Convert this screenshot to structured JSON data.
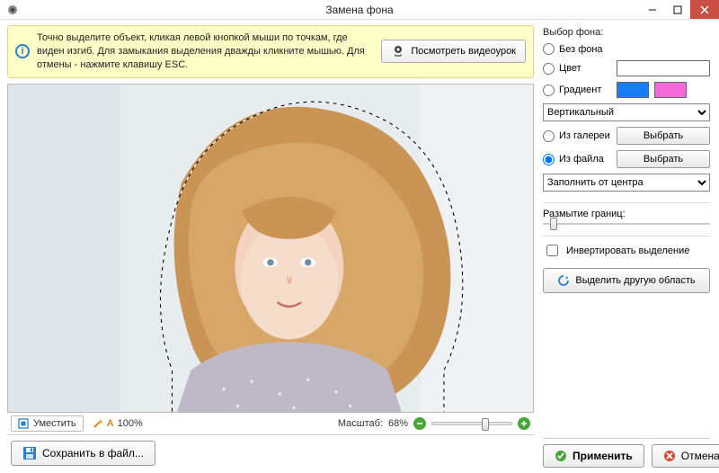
{
  "titlebar": {
    "title": "Замена фона"
  },
  "tip": {
    "text": "Точно выделите объект, кликая левой кнопкой мыши по точкам, где виден изгиб. Для замыкания выделения дважды кликните мышью. Для отмены - нажмите клавишу ESC.",
    "video_btn": "Посмотреть видеоурок"
  },
  "below": {
    "fit_btn": "Уместить",
    "auto_prefix": "A",
    "auto_value": "100%",
    "zoom_label": "Масштаб:",
    "zoom_value": "68%"
  },
  "bottom": {
    "save_btn": "Сохранить в файл...",
    "apply_btn": "Применить",
    "cancel_btn": "Отмена"
  },
  "right": {
    "section_title": "Выбор фона:",
    "opt_nobg": "Без фона",
    "opt_color": "Цвет",
    "opt_gradient": "Градиент",
    "gradient_type": "Вертикальный",
    "opt_gallery": "Из галереи",
    "opt_file": "Из файла",
    "choose_btn": "Выбрать",
    "fill_mode": "Заполнить от центра",
    "blur_label": "Размытие границ:",
    "blur_value": 5,
    "invert_label": "Инвертировать выделение",
    "reselect_btn": "Выделить другую область",
    "colors": {
      "color_swatch": "#ffffff",
      "grad_a": "#1b7ef5",
      "grad_b": "#f36bd8"
    },
    "selected_option": "Из файла"
  }
}
